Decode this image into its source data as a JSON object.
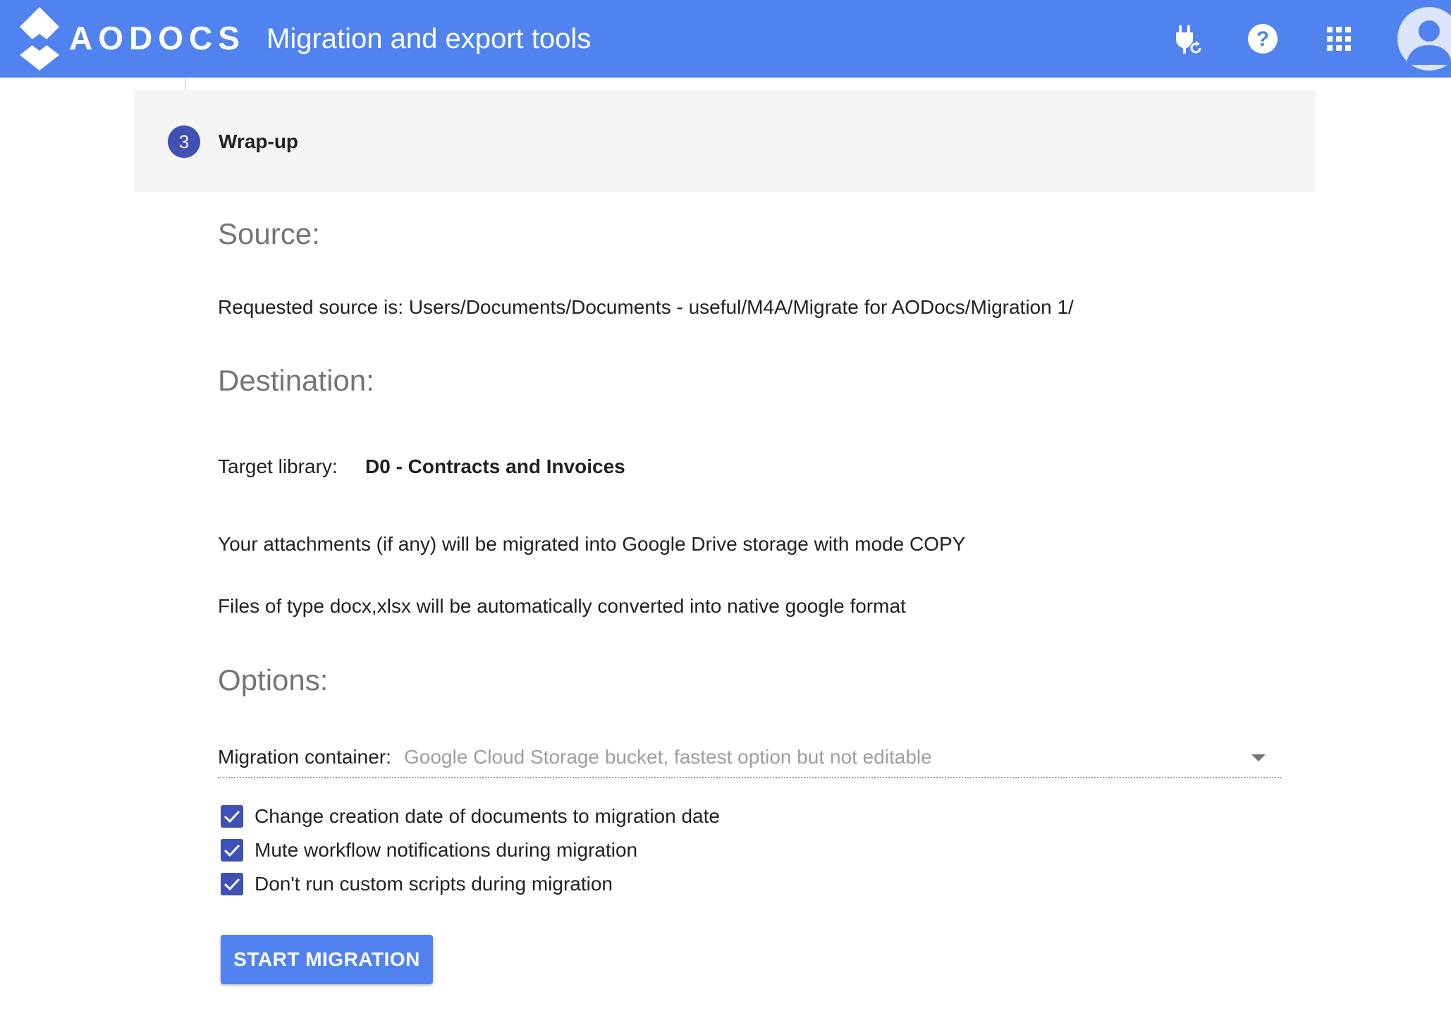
{
  "header": {
    "brand": "AODOCS",
    "title": "Migration and export tools",
    "icons": [
      "plug-refresh-icon",
      "help-icon",
      "apps-grid-icon",
      "account-avatar-icon"
    ],
    "color": "#5183f0"
  },
  "step": {
    "number": "3",
    "label": "Wrap-up"
  },
  "source": {
    "title": "Source:",
    "requested": "Requested source is: Users/Documents/Documents - useful/M4A/Migrate for AODocs/Migration 1/"
  },
  "destination": {
    "title": "Destination:",
    "target_label": "Target library:",
    "target_value": "D0 - Contracts and Invoices",
    "attachments_note": "Your attachments (if any) will be migrated into Google Drive storage with mode COPY",
    "conversion_note": "Files of type docx,xlsx will be automatically converted into native google format"
  },
  "options": {
    "title": "Options:",
    "container_label": "Migration container:",
    "container_value": "Google Cloud Storage bucket, fastest option but not editable",
    "checkboxes": [
      {
        "label": "Change creation date of documents to migration date",
        "checked": true
      },
      {
        "label": "Mute workflow notifications during migration",
        "checked": true
      },
      {
        "label": "Don't run custom scripts during migration",
        "checked": true
      }
    ]
  },
  "actions": {
    "start_label": "START MIGRATION"
  }
}
